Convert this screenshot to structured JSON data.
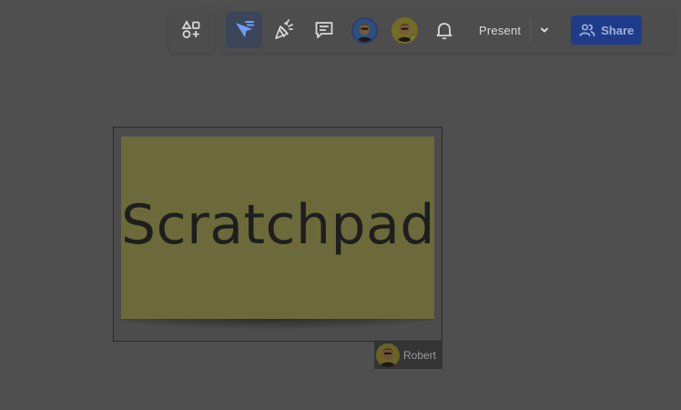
{
  "toolbar": {
    "present_label": "Present",
    "share_label": "Share",
    "icons": [
      "shapes-add-icon",
      "cursor-chat-icon",
      "celebrate-icon",
      "comments-icon",
      "bell-icon",
      "chevron-down-icon",
      "people-icon"
    ]
  },
  "collaborators": [
    {
      "name": "user-avatar-1",
      "ring_color": "#2a3f6a"
    },
    {
      "name": "user-avatar-2",
      "ring_color": "#736c26"
    }
  ],
  "canvas": {
    "sticky_text": "Scratchpad",
    "sticky_color": "#6c6a3a",
    "cursor_user": "Robert"
  },
  "colors": {
    "background": "#4f4f50",
    "share_button": "#1f3c8a",
    "active_tool": "#3b4658"
  }
}
